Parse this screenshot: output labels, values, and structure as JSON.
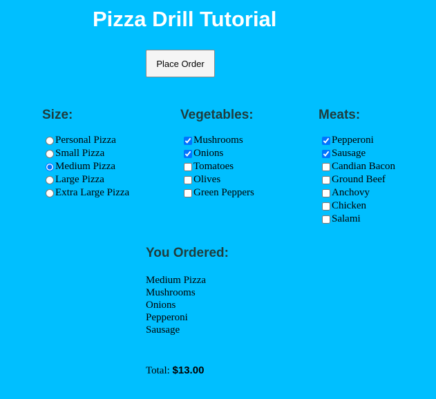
{
  "page": {
    "title": "Pizza Drill Tutorial",
    "background_color": "#00bfff",
    "title_color": "#ffffff"
  },
  "place_order_button": {
    "label": "Place Order"
  },
  "size_group": {
    "heading": "Size:",
    "options": [
      {
        "label": "Personal Pizza",
        "checked": false
      },
      {
        "label": "Small Pizza",
        "checked": false
      },
      {
        "label": "Medium Pizza",
        "checked": true
      },
      {
        "label": "Large Pizza",
        "checked": false
      },
      {
        "label": "Extra Large Pizza",
        "checked": false
      }
    ]
  },
  "vegetables_group": {
    "heading": "Vegetables:",
    "options": [
      {
        "label": "Mushrooms",
        "checked": true
      },
      {
        "label": "Onions",
        "checked": true
      },
      {
        "label": "Tomatoes",
        "checked": false
      },
      {
        "label": "Olives",
        "checked": false
      },
      {
        "label": "Green Peppers",
        "checked": false
      }
    ]
  },
  "meats_group": {
    "heading": "Meats:",
    "options": [
      {
        "label": "Pepperoni",
        "checked": true
      },
      {
        "label": "Sausage",
        "checked": true
      },
      {
        "label": "Candian Bacon",
        "checked": false
      },
      {
        "label": "Ground Beef",
        "checked": false
      },
      {
        "label": "Anchovy",
        "checked": false
      },
      {
        "label": "Chicken",
        "checked": false
      },
      {
        "label": "Salami",
        "checked": false
      }
    ]
  },
  "order_summary": {
    "heading": "You Ordered:",
    "items": [
      "Medium Pizza",
      "Mushrooms",
      "Onions",
      "Pepperoni",
      "Sausage"
    ],
    "total_label": "Total:",
    "total_value": "$13.00"
  }
}
